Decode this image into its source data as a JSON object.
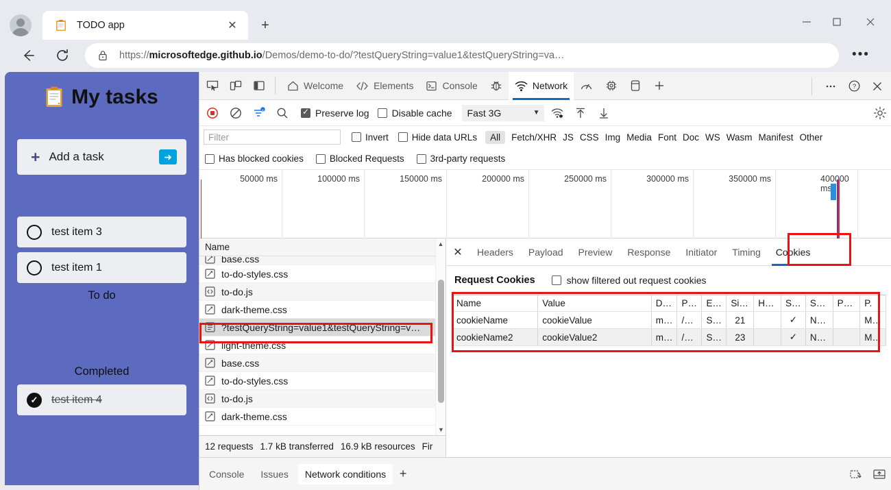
{
  "browser": {
    "tab": {
      "title": "TODO app",
      "favicon": "clipboard-icon",
      "close": "✕"
    },
    "new_tab": "+",
    "window_controls": {
      "minimize": "—",
      "maximize": "□",
      "close": "✕"
    },
    "nav": {
      "back": "←",
      "reload": "⟳",
      "more": "•••"
    },
    "url": {
      "scheme": "https://",
      "host": "microsoftedge.github.io",
      "path": "/Demos/demo-to-do/?testQueryString=value1&testQueryString=va…",
      "full": "https://microsoftedge.github.io/Demos/demo-to-do/?testQueryString=value1&testQueryString=va…"
    }
  },
  "todo_app": {
    "title": "My tasks",
    "add_task_label": "Add a task",
    "add_task_plus": "+",
    "add_task_submit": "➜",
    "sections": [
      {
        "label": "To do",
        "items": [
          {
            "text": "test item 3",
            "done": false
          },
          {
            "text": "test item 1",
            "done": false
          }
        ]
      },
      {
        "label": "Completed",
        "items": [
          {
            "text": "test item 4",
            "done": true
          }
        ]
      }
    ],
    "accent_color": "#5c6bc0"
  },
  "devtools": {
    "left_icons": [
      "inspect-icon",
      "device-toolbar-icon",
      "dock-side-icon"
    ],
    "tabs": [
      {
        "label": "Welcome",
        "icon": "home-icon",
        "active": false
      },
      {
        "label": "Elements",
        "icon": "code-brackets-icon",
        "active": false
      },
      {
        "label": "Console",
        "icon": "console-prompt-icon",
        "active": false
      },
      {
        "label": "",
        "icon": "bug-icon",
        "active": false
      },
      {
        "label": "Network",
        "icon": "network-wifi-icon",
        "active": true
      },
      {
        "label": "",
        "icon": "performance-gauge-icon",
        "active": false
      },
      {
        "label": "",
        "icon": "memory-chip-icon",
        "active": false
      },
      {
        "label": "",
        "icon": "application-storage-icon",
        "active": false
      },
      {
        "label": "",
        "icon": "plus-icon",
        "active": false
      }
    ],
    "right_icons": [
      "more-options-icon",
      "help-icon",
      "close-icon"
    ],
    "toolbar": {
      "record_icon": "record-stop-icon",
      "clear_icon": "clear-circle-slash-icon",
      "filter_icon": "filter-active-icon",
      "search_icon": "search-icon",
      "preserve_log": {
        "label": "Preserve log",
        "checked": true
      },
      "disable_cache": {
        "label": "Disable cache",
        "checked": false
      },
      "throttle": {
        "value": "Fast 3G",
        "caret": "▼"
      },
      "network_conditions_icon": "wifi-settings-icon",
      "import_icon": "upload-arrow-icon",
      "export_icon": "download-arrow-icon",
      "settings_icon": "gear-icon"
    },
    "filter_bar": {
      "placeholder": "Filter",
      "value": "",
      "invert": {
        "label": "Invert",
        "checked": false
      },
      "hide_data_urls": {
        "label": "Hide data URLs",
        "checked": false
      },
      "types": [
        "All",
        "Fetch/XHR",
        "JS",
        "CSS",
        "Img",
        "Media",
        "Font",
        "Doc",
        "WS",
        "Wasm",
        "Manifest",
        "Other"
      ],
      "active_type": "All"
    },
    "filter_bar2": [
      {
        "label": "Has blocked cookies",
        "checked": false
      },
      {
        "label": "Blocked Requests",
        "checked": false
      },
      {
        "label": "3rd-party requests",
        "checked": false
      }
    ],
    "overview": {
      "ticks": [
        "50000 ms",
        "100000 ms",
        "150000 ms",
        "200000 ms",
        "250000 ms",
        "300000 ms",
        "350000 ms",
        "400000 ms"
      ],
      "marker_color_red": "#d93025",
      "marker_color_blue": "#6633cc",
      "bar_color": "#2b8fe0"
    },
    "requests": {
      "column_header": "Name",
      "rows": [
        {
          "name": "base.css",
          "icon": "stylesheet-icon",
          "selected": false,
          "clipped": true
        },
        {
          "name": "to-do-styles.css",
          "icon": "stylesheet-icon",
          "selected": false
        },
        {
          "name": "to-do.js",
          "icon": "script-icon",
          "selected": false
        },
        {
          "name": "dark-theme.css",
          "icon": "stylesheet-icon",
          "selected": false
        },
        {
          "name": "?testQueryString=value1&testQueryString=v…",
          "icon": "document-icon",
          "selected": true
        },
        {
          "name": "light-theme.css",
          "icon": "stylesheet-icon",
          "selected": false
        },
        {
          "name": "base.css",
          "icon": "stylesheet-icon",
          "selected": false
        },
        {
          "name": "to-do-styles.css",
          "icon": "stylesheet-icon",
          "selected": false
        },
        {
          "name": "to-do.js",
          "icon": "script-icon",
          "selected": false
        },
        {
          "name": "dark-theme.css",
          "icon": "stylesheet-icon",
          "selected": false
        }
      ],
      "status": [
        "12 requests",
        "1.7 kB transferred",
        "16.9 kB resources",
        "Fir"
      ]
    },
    "details": {
      "close_icon": "✕",
      "tabs": [
        {
          "label": "Headers",
          "active": false
        },
        {
          "label": "Payload",
          "active": false
        },
        {
          "label": "Preview",
          "active": false
        },
        {
          "label": "Response",
          "active": false
        },
        {
          "label": "Initiator",
          "active": false
        },
        {
          "label": "Timing",
          "active": false
        },
        {
          "label": "Cookies",
          "active": true
        }
      ],
      "cookies": {
        "section_title": "Request Cookies",
        "show_filtered": {
          "label": "show filtered out request cookies",
          "checked": false
        },
        "columns": [
          "Name",
          "Value",
          "D…",
          "P…",
          "E…",
          "Si…",
          "H…",
          "S…",
          "S…",
          "P…",
          "P."
        ],
        "rows": [
          [
            "cookieName",
            "cookieValue",
            "m…",
            "/…",
            "S…",
            "21",
            "",
            "✓",
            "N…",
            "",
            "M…"
          ],
          [
            "cookieName2",
            "cookieValue2",
            "m…",
            "/…",
            "S…",
            "23",
            "",
            "✓",
            "N…",
            "",
            "M…"
          ]
        ]
      }
    },
    "drawer": {
      "tabs": [
        {
          "label": "Console",
          "active": false
        },
        {
          "label": "Issues",
          "active": false
        },
        {
          "label": "Network conditions",
          "active": true
        }
      ],
      "plus": "+",
      "right_icons": [
        "restore-drawer-icon",
        "dock-bottom-icon"
      ]
    }
  },
  "annotations": {
    "highlight_color": "#ee1111",
    "boxes": [
      "cookies-tab-highlight",
      "selected-request-highlight",
      "cookies-table-highlight"
    ]
  }
}
